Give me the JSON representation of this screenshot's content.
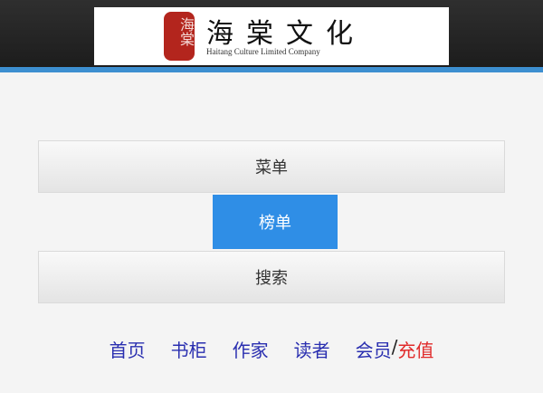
{
  "header": {
    "logo_seal_text": "海棠",
    "logo_title": "海棠文化",
    "logo_subtitle": "Haitang Culture Limited Company",
    "accent_color": "#3d8fd0"
  },
  "menu": {
    "items": [
      {
        "label": "菜单",
        "active": false
      },
      {
        "label": "榜单",
        "active": true
      },
      {
        "label": "搜索",
        "active": false
      }
    ],
    "active_color": "#2f8ee6"
  },
  "nav": {
    "home": "首页",
    "bookshelf": "书柜",
    "author": "作家",
    "reader": "读者",
    "member": "会员",
    "separator": "/",
    "recharge": "充值"
  }
}
